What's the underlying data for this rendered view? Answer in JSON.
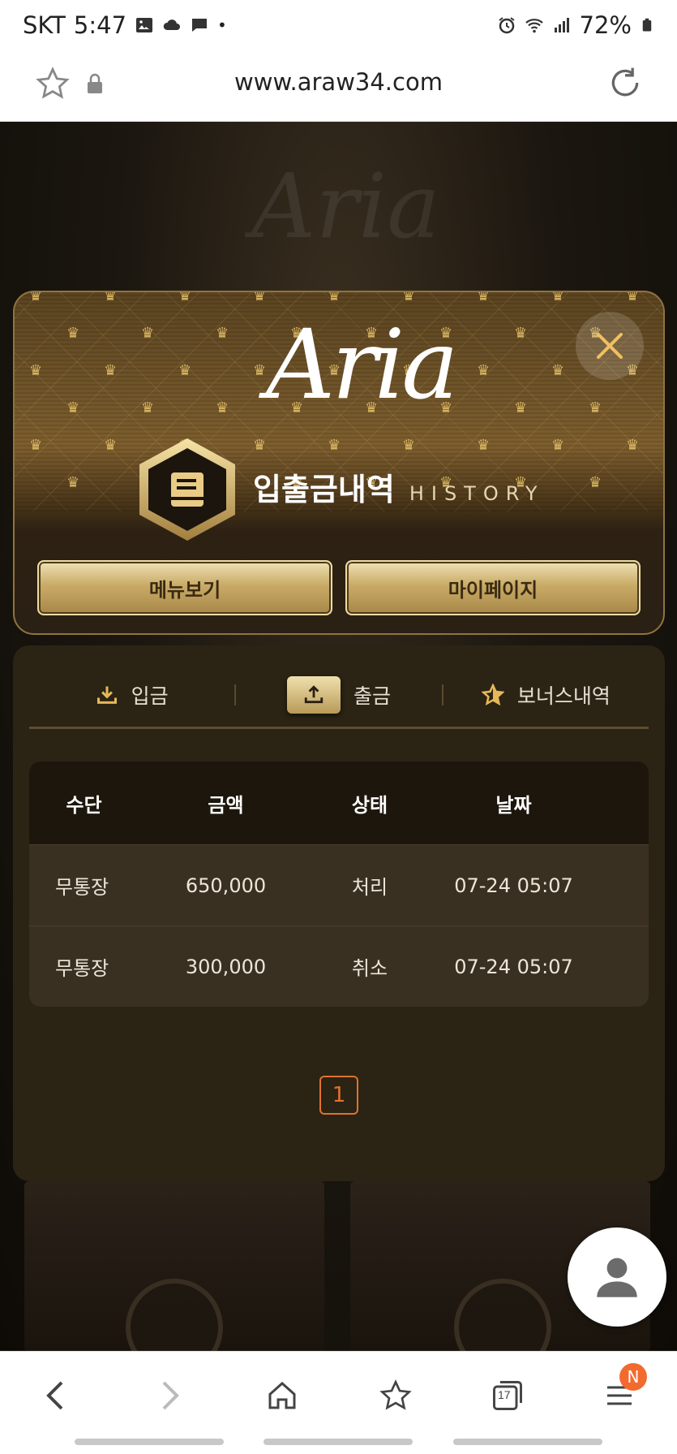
{
  "status_bar": {
    "carrier": "SKT",
    "time": "5:47",
    "battery": "72%",
    "dot": "•",
    "left_icons": [
      "image-icon",
      "cloud-icon",
      "chat-icon"
    ],
    "right_icons": [
      "alarm-icon",
      "wifi-icon",
      "signal-icon",
      "battery-icon"
    ]
  },
  "browser": {
    "url": "www.araw34.com"
  },
  "modal": {
    "logo_text": "Aria",
    "title_ko": "입출금내역",
    "title_en": "HISTORY",
    "btn_menu": "메뉴보기",
    "btn_mypage": "마이페이지"
  },
  "tabs": [
    {
      "label": "입금",
      "icon": "download-icon",
      "active": false
    },
    {
      "label": "출금",
      "icon": "upload-icon",
      "active": true
    },
    {
      "label": "보너스내역",
      "icon": "star-icon",
      "active": false
    }
  ],
  "table": {
    "headers": [
      "수단",
      "금액",
      "상태",
      "날짜"
    ],
    "rows": [
      [
        "무통장",
        "650,000",
        "처리",
        "07-24 05:07"
      ],
      [
        "무통장",
        "300,000",
        "취소",
        "07-24 05:07"
      ]
    ]
  },
  "pagination": {
    "current": "1"
  },
  "background": {
    "logo_text": "Aria"
  },
  "bottom_nav": {
    "tabs_count": "17",
    "badge": "N"
  },
  "colors": {
    "gold": "#c9ab66",
    "panel": "#2b2314",
    "page_active": "#e0722e",
    "badge": "#f26a2e"
  }
}
